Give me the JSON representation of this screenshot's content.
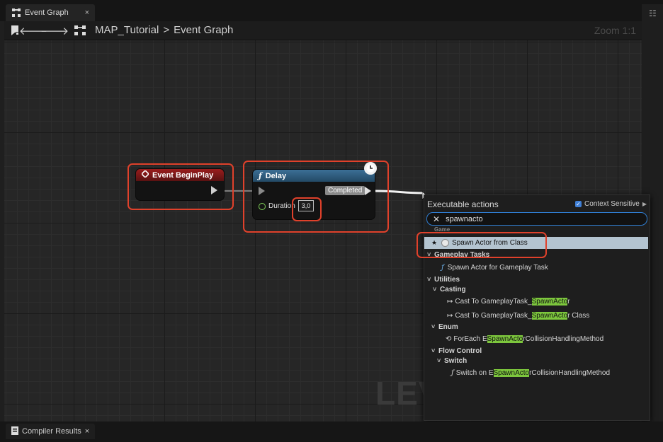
{
  "tab": {
    "title": "Event Graph",
    "close": "×"
  },
  "toolbar": {
    "breadcrumb_root": "MAP_Tutorial",
    "breadcrumb_sep": ">",
    "breadcrumb_current": "Event Graph",
    "zoom": "Zoom 1:1"
  },
  "graph": {
    "watermark": "LEV"
  },
  "nodes": {
    "begin_play": {
      "title": "Event BeginPlay"
    },
    "delay": {
      "title": "Delay",
      "completed": "Completed",
      "duration_label": "Duration",
      "duration_value": "3,0"
    }
  },
  "popup": {
    "title": "Executable actions",
    "context_label": "Context Sensitive",
    "search_value": "spawnacto",
    "partial_category": "Game",
    "rows": {
      "spawn_actor": "Spawn Actor from Class",
      "gameplay_tasks": "Gameplay Tasks",
      "spawn_actor_task": "Spawn Actor for Gameplay Task",
      "utilities": "Utilities",
      "casting": "Casting",
      "cast1_pre": "Cast To GameplayTask_",
      "cast1_mark": "SpawnActo",
      "cast1_post": "r",
      "cast2_pre": "Cast To GameplayTask_",
      "cast2_mark": "SpawnActo",
      "cast2_post": "r Class",
      "enum": "Enum",
      "foreach_pre": "ForEach E",
      "foreach_mark": "SpawnActo",
      "foreach_post": "rCollisionHandlingMethod",
      "flow_control": "Flow Control",
      "switch": "Switch",
      "switch_on_pre": "Switch on E",
      "switch_on_mark": "SpawnActo",
      "switch_on_post": "rCollisionHandlingMethod"
    }
  },
  "bottom": {
    "compiler_results": "Compiler Results",
    "close": "×"
  },
  "colors": {
    "highlight": "#e0412b",
    "search_match": "#7dc73d",
    "event_header": "#8e1a1a",
    "function_header": "#2f5878"
  }
}
